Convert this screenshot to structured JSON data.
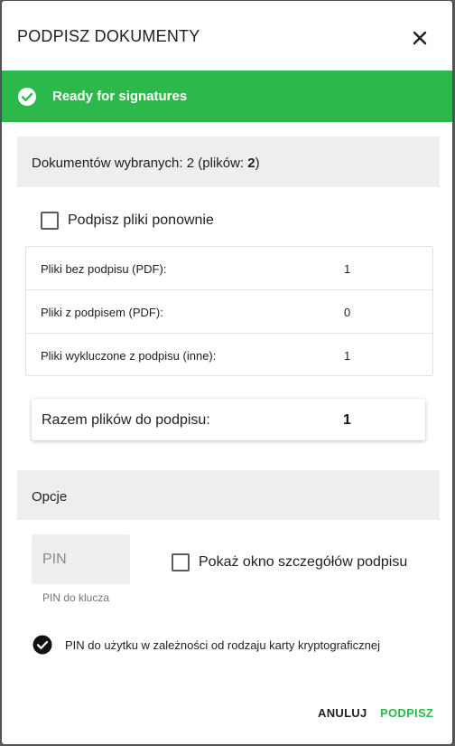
{
  "dialog": {
    "title": "PODPISZ DOKUMENTY"
  },
  "banner": {
    "text": "Ready for signatures",
    "color": "#2db84b"
  },
  "documents": {
    "prefix": "Dokumentów wybranych: 2 (plików: ",
    "files": "2",
    "suffix": ")"
  },
  "resign": {
    "label": "Podpisz pliki ponownie",
    "checked": false
  },
  "stats": [
    {
      "label": "Pliki bez podpisu (PDF):",
      "value": "1"
    },
    {
      "label": "Pliki z podpisem (PDF):",
      "value": "0"
    },
    {
      "label": "Pliki wykluczone z podpisu (inne):",
      "value": "1"
    }
  ],
  "total": {
    "label": "Razem plików do podpisu:",
    "value": "1"
  },
  "options": {
    "title": "Opcje",
    "pin_placeholder": "PIN",
    "pin_value": "",
    "pin_hint": "PIN do klucza",
    "details_label": "Pokaż okno szczegółów podpisu",
    "details_checked": false,
    "info_text": "PIN do użytku w zależności od rodzaju karty kryptograficznej"
  },
  "actions": {
    "cancel": "ANULUJ",
    "sign": "PODPISZ"
  }
}
